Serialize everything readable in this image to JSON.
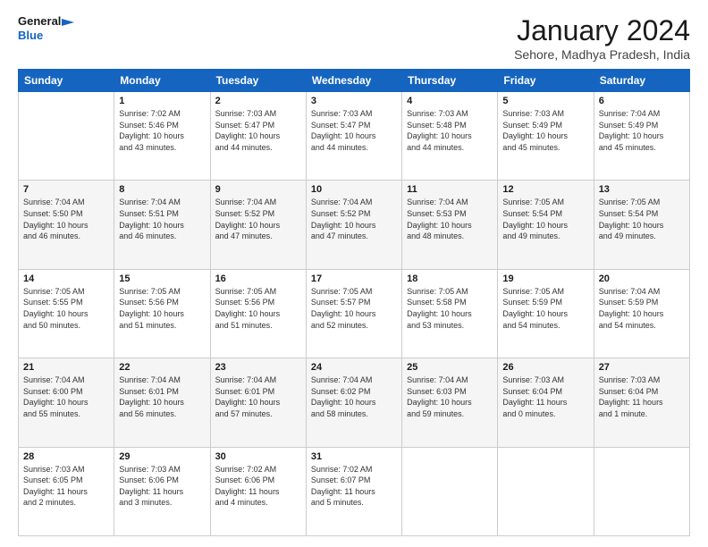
{
  "logo": {
    "line1": "General",
    "line2": "Blue"
  },
  "title": "January 2024",
  "subtitle": "Sehore, Madhya Pradesh, India",
  "headers": [
    "Sunday",
    "Monday",
    "Tuesday",
    "Wednesday",
    "Thursday",
    "Friday",
    "Saturday"
  ],
  "weeks": [
    [
      {
        "day": "",
        "info": ""
      },
      {
        "day": "1",
        "info": "Sunrise: 7:02 AM\nSunset: 5:46 PM\nDaylight: 10 hours\nand 43 minutes."
      },
      {
        "day": "2",
        "info": "Sunrise: 7:03 AM\nSunset: 5:47 PM\nDaylight: 10 hours\nand 44 minutes."
      },
      {
        "day": "3",
        "info": "Sunrise: 7:03 AM\nSunset: 5:47 PM\nDaylight: 10 hours\nand 44 minutes."
      },
      {
        "day": "4",
        "info": "Sunrise: 7:03 AM\nSunset: 5:48 PM\nDaylight: 10 hours\nand 44 minutes."
      },
      {
        "day": "5",
        "info": "Sunrise: 7:03 AM\nSunset: 5:49 PM\nDaylight: 10 hours\nand 45 minutes."
      },
      {
        "day": "6",
        "info": "Sunrise: 7:04 AM\nSunset: 5:49 PM\nDaylight: 10 hours\nand 45 minutes."
      }
    ],
    [
      {
        "day": "7",
        "info": "Sunrise: 7:04 AM\nSunset: 5:50 PM\nDaylight: 10 hours\nand 46 minutes."
      },
      {
        "day": "8",
        "info": "Sunrise: 7:04 AM\nSunset: 5:51 PM\nDaylight: 10 hours\nand 46 minutes."
      },
      {
        "day": "9",
        "info": "Sunrise: 7:04 AM\nSunset: 5:52 PM\nDaylight: 10 hours\nand 47 minutes."
      },
      {
        "day": "10",
        "info": "Sunrise: 7:04 AM\nSunset: 5:52 PM\nDaylight: 10 hours\nand 47 minutes."
      },
      {
        "day": "11",
        "info": "Sunrise: 7:04 AM\nSunset: 5:53 PM\nDaylight: 10 hours\nand 48 minutes."
      },
      {
        "day": "12",
        "info": "Sunrise: 7:05 AM\nSunset: 5:54 PM\nDaylight: 10 hours\nand 49 minutes."
      },
      {
        "day": "13",
        "info": "Sunrise: 7:05 AM\nSunset: 5:54 PM\nDaylight: 10 hours\nand 49 minutes."
      }
    ],
    [
      {
        "day": "14",
        "info": "Sunrise: 7:05 AM\nSunset: 5:55 PM\nDaylight: 10 hours\nand 50 minutes."
      },
      {
        "day": "15",
        "info": "Sunrise: 7:05 AM\nSunset: 5:56 PM\nDaylight: 10 hours\nand 51 minutes."
      },
      {
        "day": "16",
        "info": "Sunrise: 7:05 AM\nSunset: 5:56 PM\nDaylight: 10 hours\nand 51 minutes."
      },
      {
        "day": "17",
        "info": "Sunrise: 7:05 AM\nSunset: 5:57 PM\nDaylight: 10 hours\nand 52 minutes."
      },
      {
        "day": "18",
        "info": "Sunrise: 7:05 AM\nSunset: 5:58 PM\nDaylight: 10 hours\nand 53 minutes."
      },
      {
        "day": "19",
        "info": "Sunrise: 7:05 AM\nSunset: 5:59 PM\nDaylight: 10 hours\nand 54 minutes."
      },
      {
        "day": "20",
        "info": "Sunrise: 7:04 AM\nSunset: 5:59 PM\nDaylight: 10 hours\nand 54 minutes."
      }
    ],
    [
      {
        "day": "21",
        "info": "Sunrise: 7:04 AM\nSunset: 6:00 PM\nDaylight: 10 hours\nand 55 minutes."
      },
      {
        "day": "22",
        "info": "Sunrise: 7:04 AM\nSunset: 6:01 PM\nDaylight: 10 hours\nand 56 minutes."
      },
      {
        "day": "23",
        "info": "Sunrise: 7:04 AM\nSunset: 6:01 PM\nDaylight: 10 hours\nand 57 minutes."
      },
      {
        "day": "24",
        "info": "Sunrise: 7:04 AM\nSunset: 6:02 PM\nDaylight: 10 hours\nand 58 minutes."
      },
      {
        "day": "25",
        "info": "Sunrise: 7:04 AM\nSunset: 6:03 PM\nDaylight: 10 hours\nand 59 minutes."
      },
      {
        "day": "26",
        "info": "Sunrise: 7:03 AM\nSunset: 6:04 PM\nDaylight: 11 hours\nand 0 minutes."
      },
      {
        "day": "27",
        "info": "Sunrise: 7:03 AM\nSunset: 6:04 PM\nDaylight: 11 hours\nand 1 minute."
      }
    ],
    [
      {
        "day": "28",
        "info": "Sunrise: 7:03 AM\nSunset: 6:05 PM\nDaylight: 11 hours\nand 2 minutes."
      },
      {
        "day": "29",
        "info": "Sunrise: 7:03 AM\nSunset: 6:06 PM\nDaylight: 11 hours\nand 3 minutes."
      },
      {
        "day": "30",
        "info": "Sunrise: 7:02 AM\nSunset: 6:06 PM\nDaylight: 11 hours\nand 4 minutes."
      },
      {
        "day": "31",
        "info": "Sunrise: 7:02 AM\nSunset: 6:07 PM\nDaylight: 11 hours\nand 5 minutes."
      },
      {
        "day": "",
        "info": ""
      },
      {
        "day": "",
        "info": ""
      },
      {
        "day": "",
        "info": ""
      }
    ]
  ]
}
